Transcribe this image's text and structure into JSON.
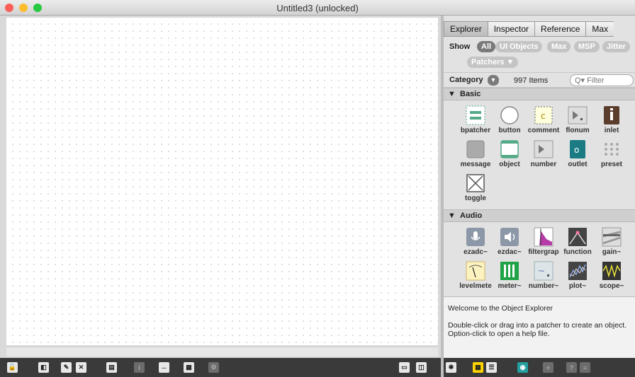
{
  "window": {
    "title": "Untitled3 (unlocked)"
  },
  "explorer": {
    "tabs": [
      "Explorer",
      "Inspector",
      "Reference",
      "Max"
    ],
    "show_label": "Show",
    "filters": [
      "All",
      "UI Objects",
      "Max",
      "MSP",
      "Jitter",
      "Patchers ▼"
    ],
    "category_label": "Category",
    "item_count": "997 Items",
    "filter_placeholder": "Filter",
    "sections": [
      {
        "name": "Basic",
        "items": [
          "bpatcher",
          "button",
          "comment",
          "flonum",
          "inlet",
          "message",
          "object",
          "number",
          "outlet",
          "preset",
          "toggle"
        ]
      },
      {
        "name": "Audio",
        "items": [
          "ezadc~",
          "ezdac~",
          "filtergrap",
          "function",
          "gain~",
          "levelmete",
          "meter~",
          "number~",
          "plot~",
          "scope~"
        ]
      }
    ],
    "help_title": "Welcome to the Object Explorer",
    "help_body": "Double-click or drag into a patcher to create an object. Option-click to open a help file."
  },
  "colors": {
    "close": "#fc5f57",
    "minimize": "#fdbc2e",
    "zoom": "#28c941",
    "selected_pill": "#7a7a7a",
    "toolbar": "#3a3a3a"
  }
}
